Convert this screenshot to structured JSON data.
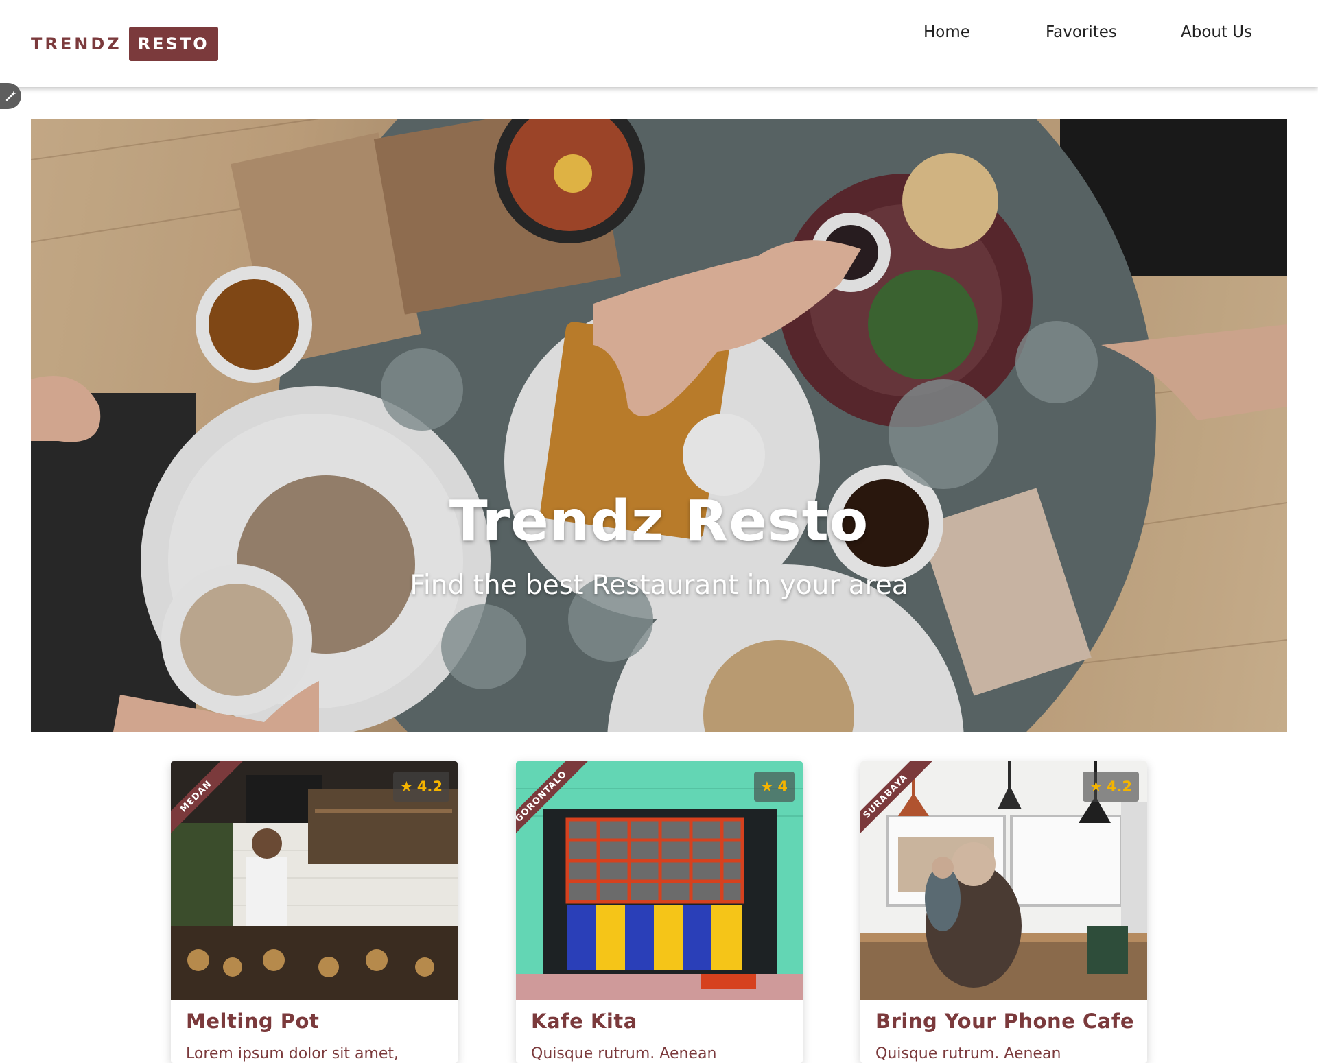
{
  "header": {
    "logo_part1": "TRENDZ",
    "logo_part2": "RESTO",
    "nav": [
      "Home",
      "Favorites",
      "About Us"
    ]
  },
  "hero": {
    "title": "Trendz Resto",
    "subtitle": "Find the best Restaurant in your area"
  },
  "restaurants": [
    {
      "city": "MEDAN",
      "rating": "4.2",
      "name": "Melting Pot",
      "description": "Lorem ipsum dolor sit amet,"
    },
    {
      "city": "GORONTALO",
      "rating": "4",
      "name": "Kafe Kita",
      "description": "Quisque rutrum. Aenean"
    },
    {
      "city": "SURABAYA",
      "rating": "4.2",
      "name": "Bring Your Phone Cafe",
      "description": "Quisque rutrum. Aenean"
    }
  ],
  "colors": {
    "brand": "#7b3a3c",
    "star": "#f4b400"
  },
  "icons": {
    "edit": "magic-wand-icon",
    "rating": "star-icon"
  }
}
